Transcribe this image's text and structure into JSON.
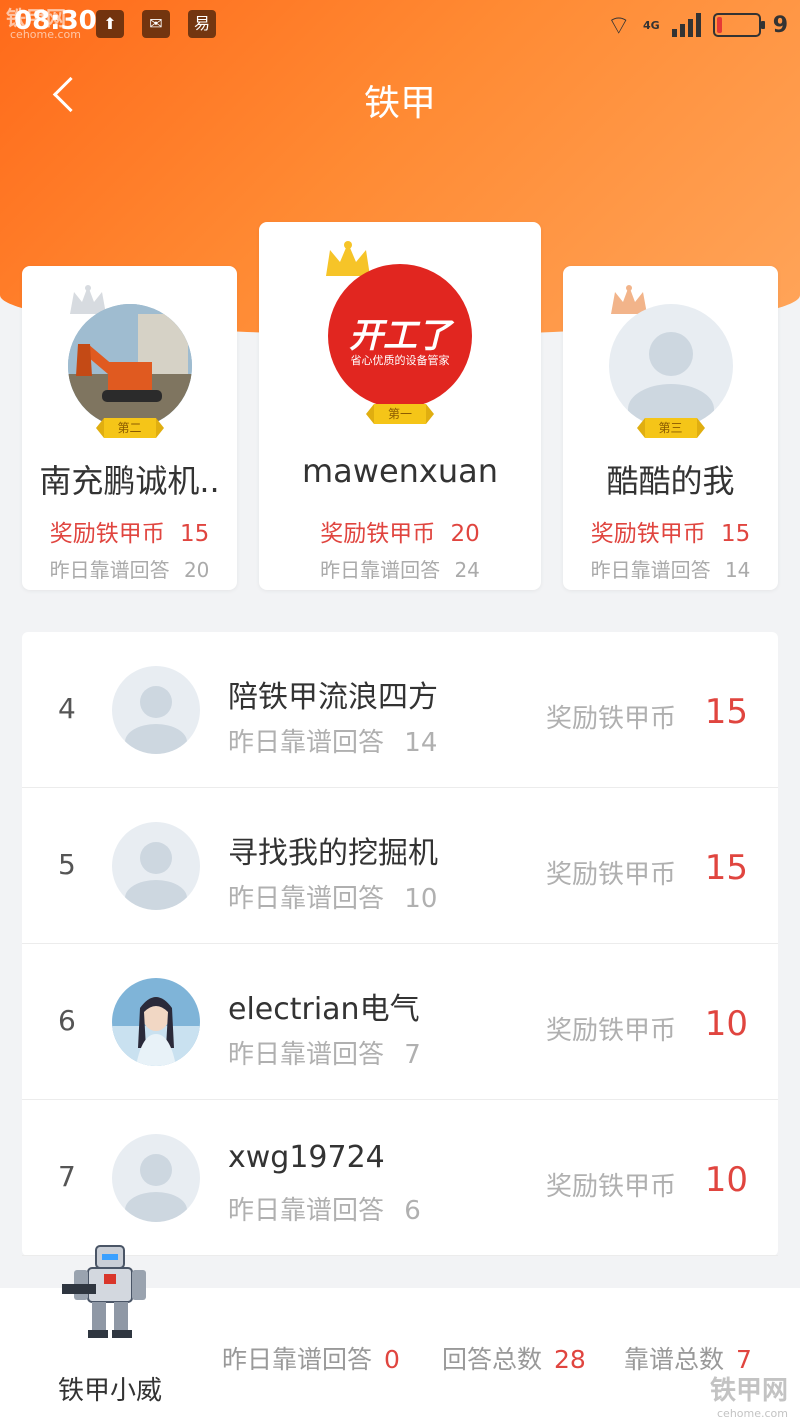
{
  "status_bar": {
    "time": "08:30",
    "network": "4G",
    "battery_level": "9",
    "watermark": "铁甲网",
    "watermark_sub": "cehome.com"
  },
  "nav": {
    "title": "铁甲"
  },
  "podium": [
    {
      "rank_badge": "第二",
      "name": "南充鹏诚机..",
      "reward_label": "奖励铁甲币",
      "reward": "15",
      "answers_label": "昨日靠谱回答",
      "answers": "20"
    },
    {
      "rank_badge": "第一",
      "name": "mawenxuan",
      "logo_text": "开工了",
      "logo_sub": "省心优质的设备管家",
      "reward_label": "奖励铁甲币",
      "reward": "20",
      "answers_label": "昨日靠谱回答",
      "answers": "24"
    },
    {
      "rank_badge": "第三",
      "name": "酷酷的我",
      "reward_label": "奖励铁甲币",
      "reward": "15",
      "answers_label": "昨日靠谱回答",
      "answers": "14"
    }
  ],
  "list": [
    {
      "rank": "4",
      "name": "陪铁甲流浪四方",
      "answers_label": "昨日靠谱回答",
      "answers": "14",
      "reward_label": "奖励铁甲币",
      "reward": "15"
    },
    {
      "rank": "5",
      "name": "寻找我的挖掘机",
      "answers_label": "昨日靠谱回答",
      "answers": "10",
      "reward_label": "奖励铁甲币",
      "reward": "15"
    },
    {
      "rank": "6",
      "name": "electrian电气",
      "answers_label": "昨日靠谱回答",
      "answers": "7",
      "reward_label": "奖励铁甲币",
      "reward": "10"
    },
    {
      "rank": "7",
      "name": "xwg19724",
      "answers_label": "昨日靠谱回答",
      "answers": "6",
      "reward_label": "奖励铁甲币",
      "reward": "10"
    }
  ],
  "bottom": {
    "name": "铁甲小威",
    "yesterday_label": "昨日靠谱回答",
    "yesterday": "0",
    "total_label": "回答总数",
    "total": "28",
    "reliable_label": "靠谱总数",
    "reliable": "7",
    "watermark": "铁甲网",
    "watermark_sub": "cehome.com"
  },
  "colors": {
    "accent": "#ff7a22",
    "reward": "#e0453f",
    "gold": "#f5c518"
  }
}
